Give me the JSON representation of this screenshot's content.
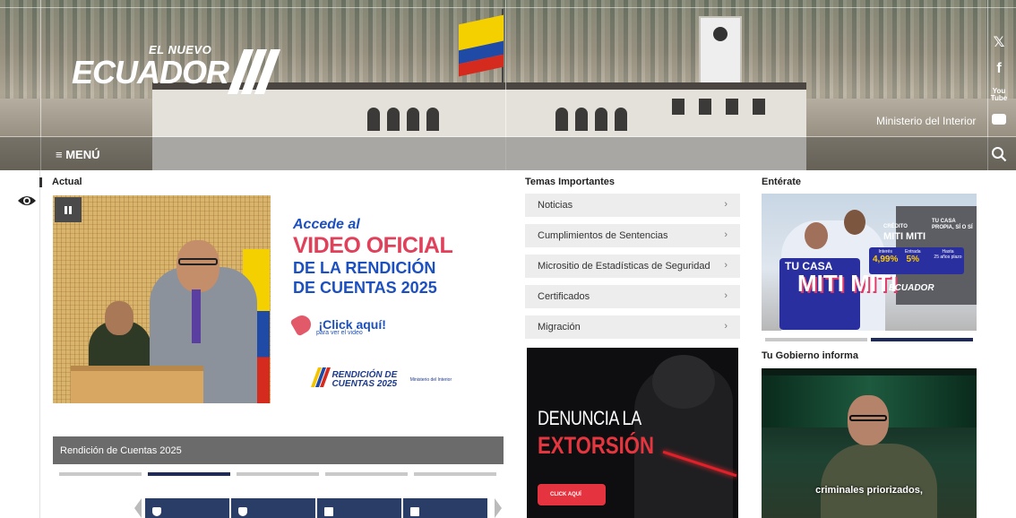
{
  "header": {
    "logo_top": "EL NUEVO",
    "logo_main": "ECUADOR",
    "ministry": "Ministerio del Interior",
    "menu_label": "≡ MENÚ",
    "social": [
      "x-icon",
      "facebook-icon",
      "youtube-icon",
      "flickr-icon"
    ],
    "youtube_text": "You Tube"
  },
  "actual": {
    "heading": "Actual",
    "slide": {
      "line1": "Accede al",
      "line2": "VIDEO OFICIAL",
      "line3": "DE LA RENDICIÓN",
      "line4": "DE CUENTAS 2025",
      "click_main": "¡Click aquí!",
      "click_sub": "para ver el video",
      "logo_text_1": "RENDICIÓN DE",
      "logo_text_2": "CUENTAS 2025",
      "logo_ministry": "Ministerio del Interior"
    },
    "caption": "Rendición de Cuentas 2025",
    "carousel_count": 5,
    "carousel_active": 2
  },
  "temas": {
    "heading": "Temas Importantes",
    "items": [
      "Noticias",
      "Cumplimientos de Sentencias",
      "Micrositio de Estadísticas de Seguridad",
      "Certificados",
      "Migración"
    ],
    "chevron": "›",
    "promo": {
      "line1": "DENUNCIA LA",
      "line2": "EXTORSIÓN",
      "button": "CLICK AQUÍ"
    }
  },
  "enterate": {
    "heading": "Entérate",
    "banner": {
      "logo_small": "CRÉDITO",
      "logo_big": "MITI MITI",
      "tucasa_small": "TU CASA PROPIA, SÍ O SÍ",
      "tucasa": "TU CASA",
      "miti": "MITI MITI",
      "rates": [
        {
          "label": "Interés",
          "value": "4,99%"
        },
        {
          "label": "Entrada",
          "value": "5%"
        },
        {
          "label": "Hasta",
          "value": "25 años plazo"
        }
      ],
      "brand": "ECUADOR"
    },
    "carousel_count": 2,
    "carousel_active": 1
  },
  "gobierno": {
    "heading": "Tu Gobierno informa",
    "subtitle": "criminales priorizados,"
  },
  "colors": {
    "navy": "#1e2a5c",
    "accent_blue": "#1c4fbf",
    "accent_red": "#e0405a",
    "tema_bg": "#ededed",
    "caption_bg": "#6b6b6b"
  }
}
